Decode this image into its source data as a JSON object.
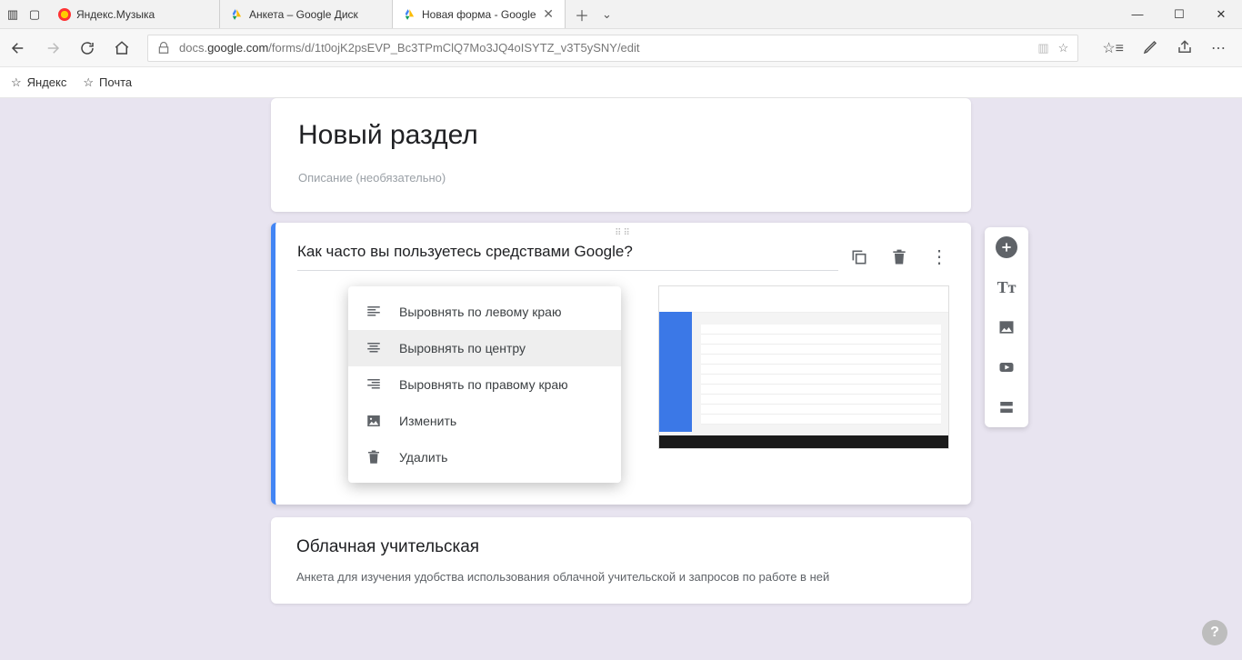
{
  "browser": {
    "tabs": [
      {
        "label": "Яндекс.Музыка",
        "icon": "yandex-music"
      },
      {
        "label": "Анкета  – Google Диск",
        "icon": "google-drive"
      },
      {
        "label": "Новая форма - Google",
        "icon": "google-drive",
        "active": true
      }
    ],
    "url_prefix": "docs.",
    "url_host": "google.com",
    "url_path": "/forms/d/1t0ojK2psEVP_Bc3TPmClQ7Mo3JQ4oISYTZ_v3T5ySNY/edit"
  },
  "bookmarks": [
    {
      "label": "Яндекс"
    },
    {
      "label": "Почта"
    }
  ],
  "section": {
    "title": "Новый раздел",
    "description_placeholder": "Описание (необязательно)"
  },
  "question": {
    "title": "Как часто вы пользуетесь средствами Google?"
  },
  "context_menu": {
    "items": [
      {
        "icon": "align-left",
        "label": "Выровнять по левому краю"
      },
      {
        "icon": "align-center",
        "label": "Выровнять по центру",
        "hover": true
      },
      {
        "icon": "align-right",
        "label": "Выровнять по правому краю"
      },
      {
        "icon": "image",
        "label": "Изменить"
      },
      {
        "icon": "delete",
        "label": "Удалить"
      }
    ]
  },
  "footer": {
    "title": "Облачная учительская",
    "desc": "Анкета для изучения удобства использования облачной учительской и запросов по работе в ней"
  },
  "toolbox_icons": [
    "add-question",
    "add-title",
    "add-image",
    "add-video",
    "add-section"
  ]
}
